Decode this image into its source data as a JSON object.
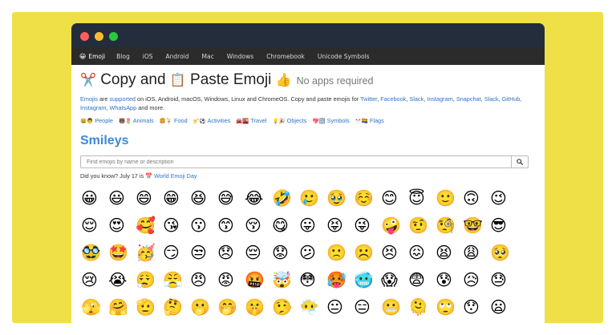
{
  "nav": {
    "brand_emoji": "😀",
    "brand_label": "Emoji",
    "items": [
      "Blog",
      "iOS",
      "Android",
      "Mac",
      "Windows",
      "Chromebook",
      "Unicode Symbols"
    ]
  },
  "headline": {
    "scissors": "✂️",
    "copy": "Copy and",
    "clipboard": "📋",
    "paste": "Paste Emoji",
    "thumb": "👍",
    "tagline": "No apps required"
  },
  "intro": {
    "emojis_link": "Emojis",
    "are": "are",
    "supported_link": "supported",
    "platforms_text": "on iOS, Android, macOS, Windows, Linux and ChromeOS. Copy and paste emojis for",
    "apps": [
      "Twitter",
      "Facebook",
      "Slack",
      "Instagram",
      "Snapchat",
      "Slack",
      "GitHub",
      "Instagram",
      "WhatsApp"
    ],
    "and_more": "and more."
  },
  "categories": [
    {
      "emoji": "😃👨",
      "label": "People"
    },
    {
      "emoji": "🐻🌷",
      "label": "Animals"
    },
    {
      "emoji": "🍔🍹",
      "label": "Food"
    },
    {
      "emoji": "🎷⚽️",
      "label": "Activities"
    },
    {
      "emoji": "🚘🌇",
      "label": "Travel"
    },
    {
      "emoji": "💡🎉",
      "label": "Objects"
    },
    {
      "emoji": "💖🔣",
      "label": "Symbols"
    },
    {
      "emoji": "🎌🏳️‍🌈",
      "label": "Flags"
    }
  ],
  "section_title": "Smileys",
  "search": {
    "placeholder": "Find emojis by name or description",
    "button_icon": "search-icon"
  },
  "didyouknow": {
    "text": "Did you know? July 17 is",
    "link_emoji": "📅",
    "link_text": "World Emoji Day"
  },
  "emojis": [
    "😀",
    "😃",
    "😄",
    "😁",
    "😆",
    "😅",
    "😂",
    "🤣",
    "🥲",
    "🥹",
    "☺️",
    "😊",
    "😇",
    "🙂",
    "🙃",
    "😉",
    "😌",
    "😍",
    "🥰",
    "😘",
    "😗",
    "😙",
    "😚",
    "😋",
    "😛",
    "😝",
    "😜",
    "🤪",
    "🤨",
    "🧐",
    "🤓",
    "😎",
    "🥸",
    "🤩",
    "🥳",
    "😏",
    "😒",
    "😞",
    "😔",
    "😟",
    "😕",
    "🙁",
    "☹️",
    "😣",
    "😖",
    "😫",
    "😩",
    "🥺",
    "😢",
    "😭",
    "😮‍💨",
    "😤",
    "😠",
    "😡",
    "🤬",
    "🤯",
    "😳",
    "🥵",
    "🥶",
    "😱",
    "😨",
    "😰",
    "😥",
    "😓",
    "🫣",
    "🤗",
    "🫡",
    "🤔",
    "🫢",
    "🤭",
    "🤫",
    "🤥",
    "😶‍🌫️",
    "😐",
    "😑",
    "😬",
    "🫠",
    "🙄",
    "😯",
    "😦",
    "😧",
    "😮",
    "😲",
    "🥱",
    "😴"
  ]
}
